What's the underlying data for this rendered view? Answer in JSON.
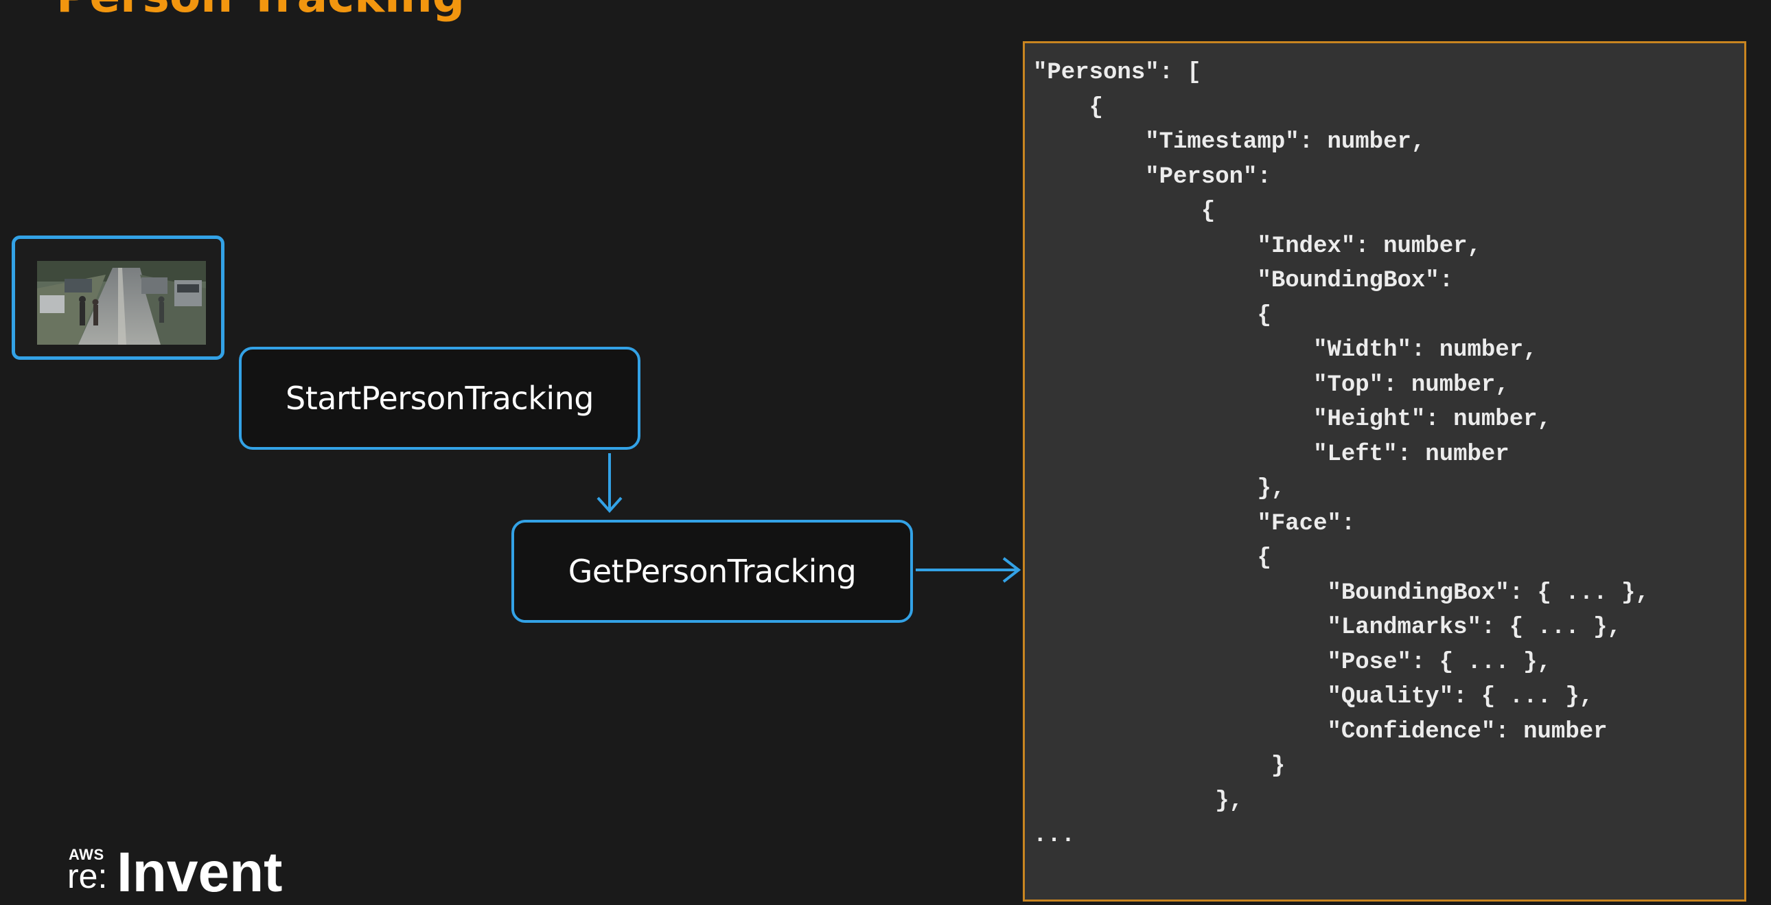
{
  "slide": {
    "title": "Person Tracking"
  },
  "diagram": {
    "video_thumbnail": "street-video-thumbnail",
    "start_api": "StartPersonTracking",
    "get_api": "GetPersonTracking"
  },
  "json_response": {
    "lines": [
      "\"Persons\": [",
      "    {",
      "        \"Timestamp\": number,",
      "        \"Person\":",
      "            {",
      "                \"Index\": number,",
      "                \"BoundingBox\":",
      "                {",
      "                    \"Width\": number,",
      "                    \"Top\": number,",
      "                    \"Height\": number,",
      "                    \"Left\": number",
      "                },",
      "                \"Face\":",
      "                {",
      "                     \"BoundingBox\": { ... },",
      "                     \"Landmarks\": { ... },",
      "                     \"Pose\": { ... },",
      "                     \"Quality\": { ... },",
      "                     \"Confidence\": number",
      "                 }",
      "             },",
      "..."
    ]
  },
  "branding": {
    "logo_small": "AWS",
    "logo_prefix": "re:",
    "logo_main": "Invent"
  },
  "colors": {
    "background": "#1a1a1a",
    "title": "#f2960f",
    "box_border": "#33a2e6",
    "panel_border": "#c98520",
    "panel_background": "#333333"
  }
}
